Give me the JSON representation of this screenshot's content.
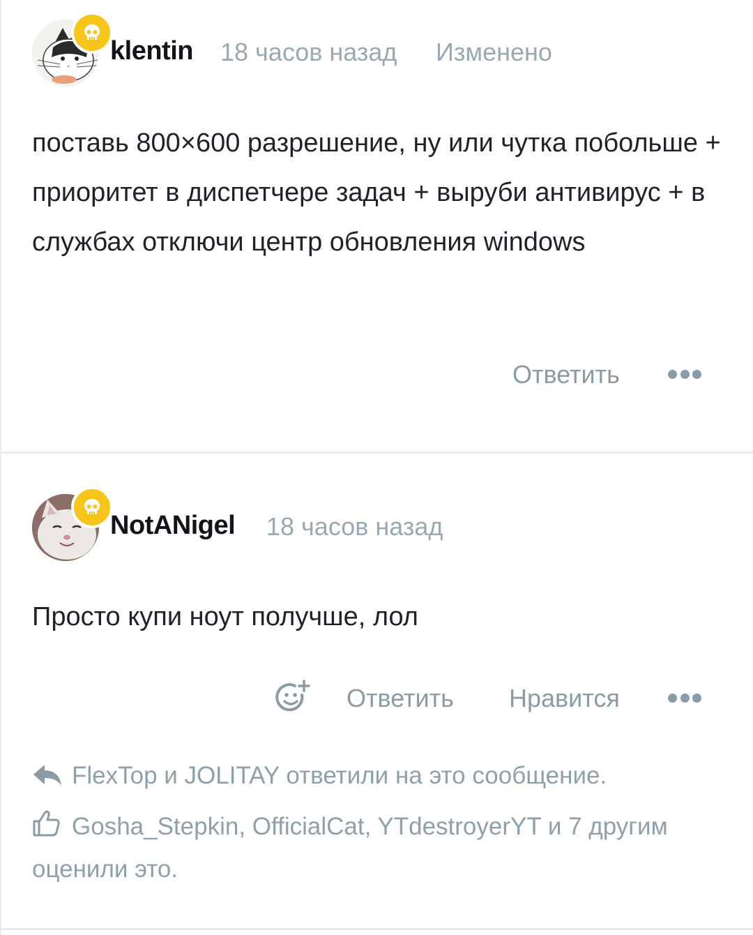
{
  "comments": [
    {
      "username": "klentin",
      "time": "18 часов назад",
      "edited": "Изменено",
      "text": "поставь 800×600 разрешение, ну или чутка побольше + приоритет в диспетчере задач + выруби антивирус + в службах отключи центр обновления windows",
      "reply_label": "Ответить"
    },
    {
      "username": "NotANigel",
      "time": "18 часов назад",
      "text": "Просто купи ноут получше, лол",
      "reply_label": "Ответить",
      "like_label": "Нравится",
      "replies_info": "FlexTop и JOLITAY ответили на это сообщение.",
      "likes_info_line1": "Gosha_Stepkin, OfficialCat, YTdestroyerYT и 7 другим",
      "likes_info_line2": "оценили это."
    }
  ],
  "colors": {
    "badge": "#f7c41a",
    "meta_text": "#9aa8b2",
    "action_text": "#8b9ba6",
    "separator": "#e5edf1"
  },
  "icons": {
    "badge": "skull-icon",
    "more": "more-dots-icon",
    "react": "add-emoji-icon",
    "reply_arrow": "reply-arrow-icon",
    "like": "thumbs-up-icon"
  }
}
